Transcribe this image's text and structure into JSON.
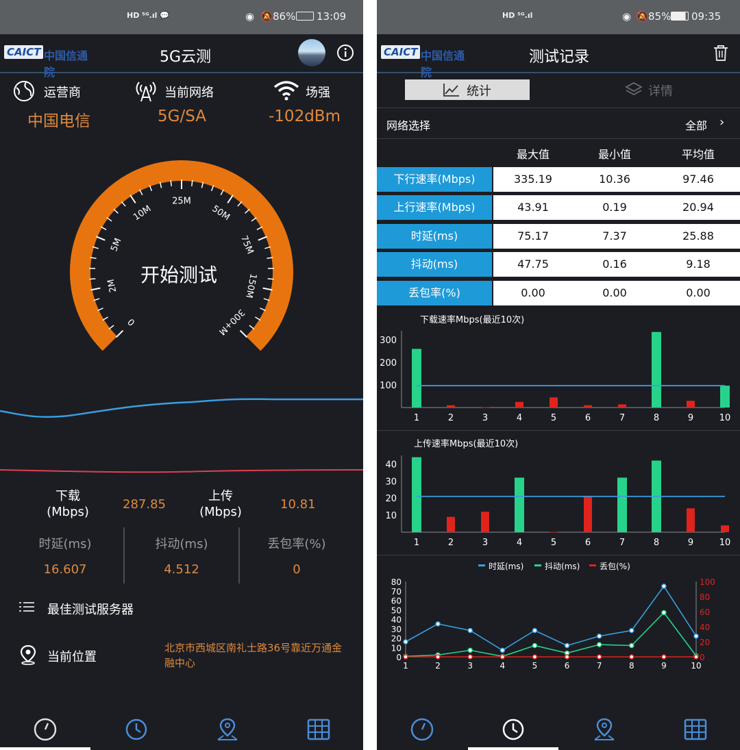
{
  "left": {
    "status": {
      "left": "HD ⁵ᴳ.ıl 💬",
      "battery": "86%",
      "time": "13:09"
    },
    "logo_en": "CAICT",
    "logo_cn": "中国信通院",
    "title": "5G云测",
    "carrier_label": "运营商",
    "carrier_value": "中国电信",
    "network_label": "当前网络",
    "network_value": "5G/SA",
    "signal_label": "场强",
    "signal_value": "-102dBm",
    "gauge": {
      "center_text": "开始测试",
      "ticks": [
        "0",
        "2M",
        "5M",
        "10M",
        "25M",
        "50M",
        "75M",
        "150M",
        "300+M"
      ]
    },
    "download_label_1": "下载",
    "download_label_2": "(Mbps)",
    "download_value": "287.85",
    "upload_label_1": "上传",
    "upload_label_2": "(Mbps)",
    "upload_value": "10.81",
    "latency_label": "时延(ms)",
    "latency_value": "16.607",
    "jitter_label": "抖动(ms)",
    "jitter_value": "4.512",
    "loss_label": "丢包率(%)",
    "loss_value": "0",
    "best_server": "最佳测试服务器",
    "location_label": "当前位置",
    "address_line1": "北京市西城区南礼士路36号靠近万通金",
    "address_line2": "融中心"
  },
  "right": {
    "status": {
      "left": "HD ⁵ᴳ.ıl",
      "battery": "85%",
      "time": "09:35"
    },
    "title": "测试记录",
    "tab_stats": "统计",
    "tab_detail": "详情",
    "network_select": "网络选择",
    "network_value": "全部",
    "headers": [
      "最大值",
      "最小值",
      "平均值"
    ],
    "rows": [
      {
        "name": "下行速率(Mbps)",
        "max": "335.19",
        "min": "10.36",
        "avg": "97.46"
      },
      {
        "name": "上行速率(Mbps)",
        "max": "43.91",
        "min": "0.19",
        "avg": "20.94"
      },
      {
        "name": "时延(ms)",
        "max": "75.17",
        "min": "7.37",
        "avg": "25.88"
      },
      {
        "name": "抖动(ms)",
        "max": "47.75",
        "min": "0.16",
        "avg": "9.18"
      },
      {
        "name": "丢包率(%)",
        "max": "0.00",
        "min": "0.00",
        "avg": "0.00"
      }
    ]
  },
  "colors": {
    "orange": "#e8740f",
    "accent_text": "#e08a3c",
    "blue": "#1e9ad8",
    "green": "#27d38a",
    "red": "#e0231c",
    "line_blue": "#3a9ee0"
  },
  "chart_data": [
    {
      "type": "bar",
      "title": "下载速率Mbps(最近10次)",
      "categories": [
        "1",
        "2",
        "3",
        "4",
        "5",
        "6",
        "7",
        "8",
        "9",
        "10"
      ],
      "series": [
        {
          "values": [
            260,
            null,
            null,
            null,
            null,
            null,
            null,
            335,
            null,
            97
          ]
        },
        {
          "values": [
            null,
            10,
            2,
            25,
            45,
            10,
            14,
            null,
            30,
            null
          ]
        }
      ],
      "average_line": 97,
      "yticks": [
        100,
        200,
        300
      ],
      "ylim": [
        0,
        340
      ]
    },
    {
      "type": "bar",
      "title": "上传速率Mbps(最近10次)",
      "categories": [
        "1",
        "2",
        "3",
        "4",
        "5",
        "6",
        "7",
        "8",
        "9",
        "10"
      ],
      "series": [
        {
          "values": [
            44,
            null,
            null,
            32,
            null,
            null,
            32,
            42,
            null,
            null
          ]
        },
        {
          "values": [
            null,
            9,
            12,
            null,
            0.2,
            21,
            null,
            null,
            14,
            4
          ]
        }
      ],
      "average_line": 21,
      "yticks": [
        10,
        20,
        30,
        40
      ],
      "ylim": [
        0,
        45
      ]
    },
    {
      "type": "line",
      "x": [
        1,
        2,
        3,
        4,
        5,
        6,
        7,
        8,
        9,
        10
      ],
      "series": [
        {
          "name": "时延(ms)",
          "values": [
            16,
            35,
            28,
            7,
            28,
            12,
            22,
            28,
            75,
            22
          ]
        },
        {
          "name": "抖动(ms)",
          "values": [
            0.5,
            2,
            7,
            0.5,
            12,
            4,
            13,
            12,
            47,
            1
          ]
        },
        {
          "name": "丢包(%)",
          "axis": "right",
          "values": [
            0,
            0,
            0,
            0,
            0,
            0,
            0,
            0,
            0,
            0
          ]
        }
      ],
      "yticks_left": [
        0,
        10,
        20,
        30,
        40,
        50,
        60,
        70,
        80
      ],
      "yticks_right": [
        0,
        20,
        40,
        60,
        80,
        100
      ],
      "ylim_left": [
        0,
        80
      ],
      "ylim_right": [
        0,
        100
      ]
    }
  ]
}
